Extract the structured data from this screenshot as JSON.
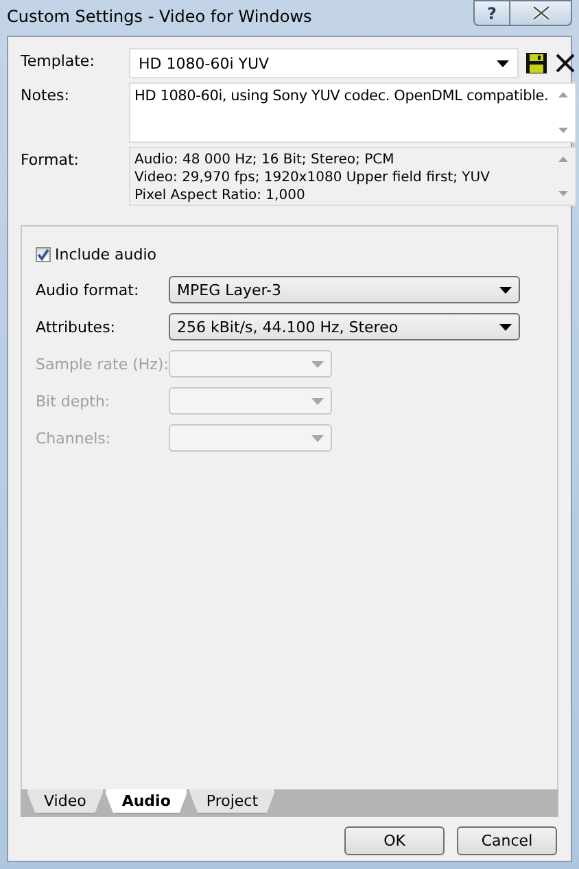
{
  "window": {
    "title": "Custom Settings - Video for Windows",
    "help_button": "?"
  },
  "template": {
    "label": "Template:",
    "value": "HD 1080-60i YUV"
  },
  "notes": {
    "label": "Notes:",
    "value": "HD 1080-60i, using Sony YUV codec. OpenDML compatible."
  },
  "format": {
    "label": "Format:",
    "lines": [
      "Audio: 48 000 Hz; 16 Bit; Stereo; PCM",
      "Video: 29,970 fps; 1920x1080 Upper field first; YUV",
      "Pixel Aspect Ratio: 1,000"
    ]
  },
  "include_audio": {
    "label": "Include audio",
    "checked": true
  },
  "fields": [
    {
      "label": "Audio format:",
      "value": "MPEG Layer-3",
      "disabled": false
    },
    {
      "label": "Attributes:",
      "value": "256 kBit/s, 44.100 Hz, Stereo",
      "disabled": false
    },
    {
      "label": "Sample rate (Hz):",
      "disabled": true
    },
    {
      "label": "Bit depth:",
      "disabled": true
    },
    {
      "label": "Channels:",
      "disabled": true
    }
  ],
  "tabs": [
    {
      "label": "Video",
      "selected": false
    },
    {
      "label": "Audio",
      "selected": true
    },
    {
      "label": "Project",
      "selected": false
    }
  ],
  "buttons": [
    "OK",
    "Cancel"
  ]
}
